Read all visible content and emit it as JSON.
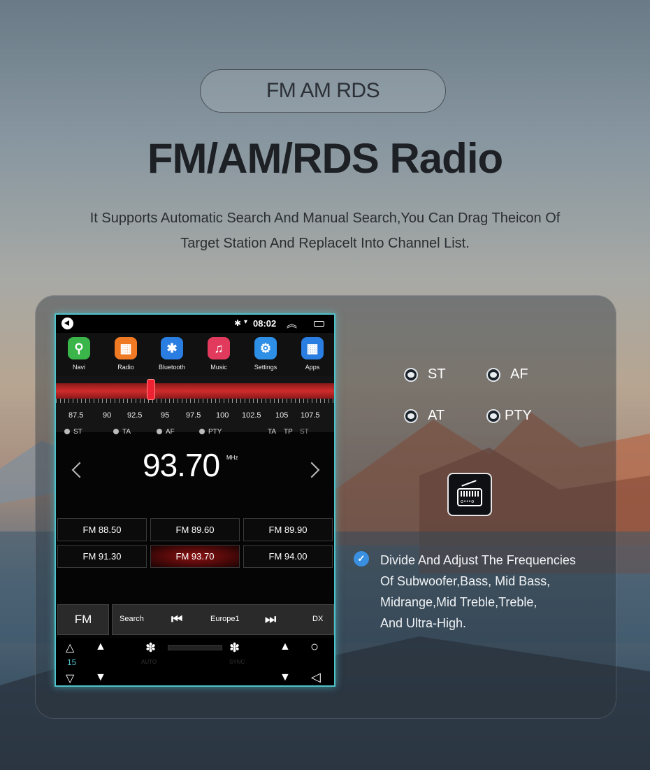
{
  "badge": "FM AM RDS",
  "heading": "FM/AM/RDS Radio",
  "desc_line1": "It Supports Automatic Search And Manual Search,You Can Drag Theicon Of",
  "desc_line2": "Target Station And Replacelt Into Channel List.",
  "status": {
    "time": "08:02",
    "bt": "✱",
    "wifi": "▾",
    "up": "︽"
  },
  "apps": [
    {
      "label": "Navi",
      "color": "#3ab54a",
      "glyph": "⚲"
    },
    {
      "label": "Radio",
      "color": "#f07a23",
      "glyph": "▦"
    },
    {
      "label": "Bluetooth",
      "color": "#2a7de1",
      "glyph": "✱"
    },
    {
      "label": "Music",
      "color": "#e23a5c",
      "glyph": "♫"
    },
    {
      "label": "Settings",
      "color": "#2d8fe6",
      "glyph": "⚙"
    },
    {
      "label": "Apps",
      "color": "#2a7de1",
      "glyph": "▦"
    }
  ],
  "scale": [
    "87.5",
    "90",
    "92.5",
    "95",
    "97.5",
    "100",
    "102.5",
    "105",
    "107.5"
  ],
  "flags": {
    "st": "ST",
    "ta": "TA",
    "af": "AF",
    "pty": "PTY",
    "r_ta": "TA",
    "r_tp": "TP",
    "r_st": "ST"
  },
  "frequency": "93.70",
  "unit": "MHz",
  "presets": [
    "FM  88.50",
    "FM  89.60",
    "FM  89.90",
    "FM  91.30",
    "FM  93.70",
    "FM  94.00"
  ],
  "controls": {
    "band": "FM",
    "search": "Search",
    "station": "Europe1",
    "dx": "DX",
    "prev": "⏮",
    "next": "⏭"
  },
  "climate": {
    "temp": "15",
    "auto": "AUTO",
    "sync": "SYNC"
  },
  "options": [
    "ST",
    "AF",
    "AT",
    "PTY"
  ],
  "feature": [
    "Divide And Adjust The Frequencies",
    "Of Subwoofer,Bass, Mid Bass,",
    "Midrange,Mid Treble,Treble,",
    "And Ultra-High."
  ]
}
